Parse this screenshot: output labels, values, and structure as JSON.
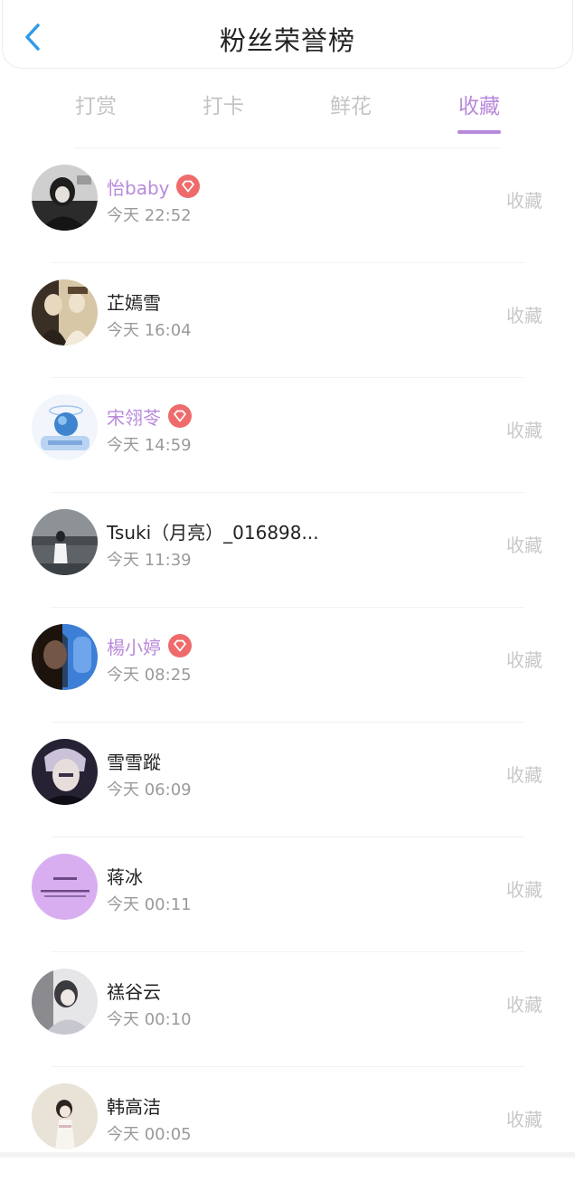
{
  "header": {
    "title": "粉丝荣誉榜",
    "back_icon": "chevron-left-icon"
  },
  "tabs": [
    {
      "label": "打赏",
      "active": false
    },
    {
      "label": "打卡",
      "active": false
    },
    {
      "label": "鲜花",
      "active": false
    },
    {
      "label": "收藏",
      "active": true
    }
  ],
  "colors": {
    "accent": "#b889db",
    "back_icon": "#2f9be8",
    "badge": "#ef6b6b"
  },
  "fans": [
    {
      "name": "怡baby",
      "time": "今天 22:52",
      "action": "收藏",
      "vip": true
    },
    {
      "name": "芷嫣雪",
      "time": "今天 16:04",
      "action": "收藏",
      "vip": false
    },
    {
      "name": "宋翎苓",
      "time": "今天 14:59",
      "action": "收藏",
      "vip": true
    },
    {
      "name": "Tsuki（月亮）_016898...",
      "time": "今天 11:39",
      "action": "收藏",
      "vip": false
    },
    {
      "name": "楊小婷",
      "time": "今天 08:25",
      "action": "收藏",
      "vip": true
    },
    {
      "name": "雪雪蹤",
      "time": "今天 06:09",
      "action": "收藏",
      "vip": false
    },
    {
      "name": "蒋冰",
      "time": "今天 00:11",
      "action": "收藏",
      "vip": false
    },
    {
      "name": "禚谷云",
      "time": "今天 00:10",
      "action": "收藏",
      "vip": false
    },
    {
      "name": "韩高洁",
      "time": "今天 00:05",
      "action": "收藏",
      "vip": false
    }
  ]
}
